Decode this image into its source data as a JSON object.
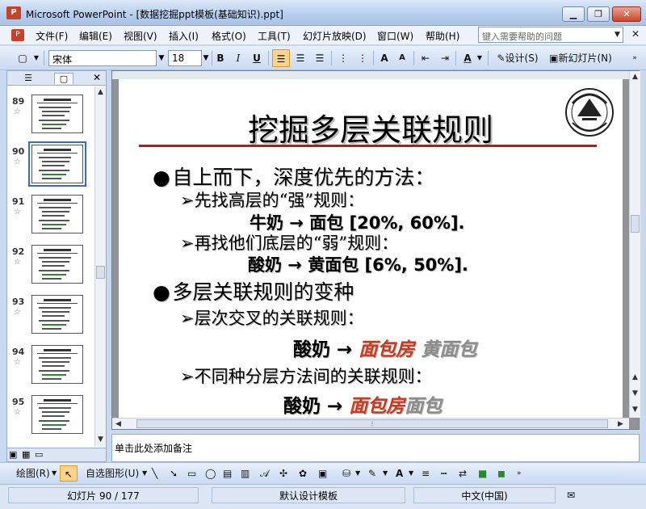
{
  "window": {
    "title": "Microsoft PowerPoint - [数据挖掘ppt模板(基础知识).ppt]",
    "minimize": "▁",
    "restore": "❐",
    "close": "✕"
  },
  "menubar": {
    "items": [
      "文件(F)",
      "编辑(E)",
      "视图(V)",
      "插入(I)",
      "格式(O)",
      "工具(T)",
      "幻灯片放映(D)",
      "窗口(W)",
      "帮助(H)"
    ],
    "help_placeholder": "键入需要帮助的问题",
    "close_doc": "✕"
  },
  "toolbar": {
    "font_name": "宋体",
    "font_size": "18",
    "bold": "B",
    "italic": "I",
    "underline": "U",
    "design": "设计(S)",
    "new_slide": "新幻灯片(N)",
    "font_color_label": "A"
  },
  "slides_pane": {
    "thumbnails": [
      {
        "number": "89",
        "star": "☆"
      },
      {
        "number": "90",
        "star": "☆",
        "selected": true
      },
      {
        "number": "91",
        "star": "☆"
      },
      {
        "number": "92",
        "star": "☆"
      },
      {
        "number": "93",
        "star": "☆"
      },
      {
        "number": "94",
        "star": "☆"
      },
      {
        "number": "95",
        "star": "☆"
      }
    ]
  },
  "slide": {
    "title": "挖掘多层关联规则",
    "b1": "自上而下，深度优先的方法：",
    "b1_1": "先找高层的“强”规则：",
    "b1_1_rule": "牛奶 → 面包 [20%, 60%].",
    "b1_2": "再找他们底层的“弱”规则：",
    "b1_2_rule": "酸奶 → 黄面包 [6%, 50%].",
    "b2": "多层关联规则的变种",
    "b2_1": "层次交叉的关联规则：",
    "b2_1_rule_lhs": "酸奶 →",
    "b2_1_rule_red": "面包房",
    "b2_1_rule_gray": "黄面包",
    "b2_2": "不同种分层方法间的关联规则：",
    "b2_2_rule_lhs": "酸奶 →",
    "b2_2_rule_red": "面包房",
    "b2_2_rule_gray": "面包"
  },
  "notes": {
    "placeholder": "单击此处添加备注"
  },
  "drawbar": {
    "draw": "绘图(R)",
    "autoshapes": "自选图形(U)"
  },
  "statusbar": {
    "slide_pos": "幻灯片 90 / 177",
    "template": "默认设计模板",
    "language": "中文(中国)"
  },
  "colors": {
    "accent_red": "#c9391f",
    "title_rule": "#b01e16",
    "selection": "#3a6bc4"
  }
}
